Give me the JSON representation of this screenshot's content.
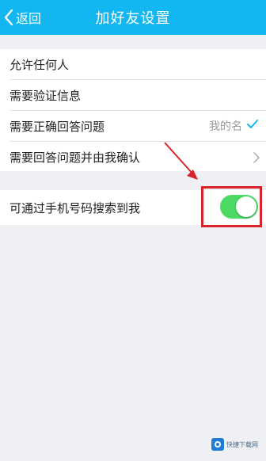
{
  "header": {
    "back_label": "返回",
    "title": "加好友设置"
  },
  "options": [
    {
      "label": "允许任何人"
    },
    {
      "label": "需要验证信息"
    },
    {
      "label": "需要正确回答问题",
      "value": "我的名",
      "checked": true
    },
    {
      "label": "需要回答问题并由我确认"
    }
  ],
  "phone_search": {
    "label": "可通过手机号码搜索到我",
    "enabled": true
  },
  "colors": {
    "header": "#12b6f0",
    "toggle_on": "#4cd964",
    "annotation": "#d8232a"
  },
  "watermark": {
    "text": "快捷下载网"
  }
}
